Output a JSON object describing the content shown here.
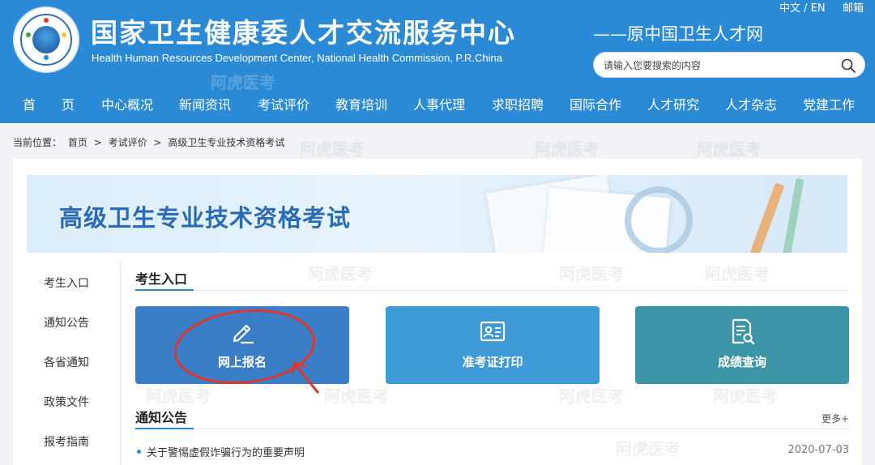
{
  "header": {
    "title_cn": "国家卫生健康委人才交流服务中心",
    "title_en": "Health Human Resources Development Center, National Health Commission, P.R.China",
    "former_name": "——原中国卫生人才网",
    "lang_switch": "中文 / EN",
    "mail": "邮箱",
    "search_placeholder": "请输入您要搜索的内容"
  },
  "nav": {
    "items": [
      "首　　页",
      "中心概况",
      "新闻资讯",
      "考试评价",
      "教育培训",
      "人事代理",
      "求职招聘",
      "国际合作",
      "人才研究",
      "人才杂志",
      "党建工作"
    ]
  },
  "breadcrumb": {
    "prefix": "当前位置：",
    "items": [
      "首页",
      ">",
      "考试评价",
      ">",
      "高级卫生专业技术资格考试"
    ]
  },
  "banner": {
    "title": "高级卫生专业技术资格考试"
  },
  "sidebar": {
    "items": [
      "考生入口",
      "通知公告",
      "各省通知",
      "政策文件",
      "报考指南"
    ]
  },
  "entry": {
    "title": "考生入口",
    "cards": [
      {
        "label": "网上报名",
        "icon": "edit-pen-icon",
        "color": "#3a7ec7"
      },
      {
        "label": "准考证打印",
        "icon": "id-card-icon",
        "color": "#3f9ad8"
      },
      {
        "label": "成绩查询",
        "icon": "document-search-icon",
        "color": "#3b95a6"
      }
    ]
  },
  "notices": {
    "title": "通知公告",
    "more": "更多+",
    "items": [
      {
        "title": "关于警惕虚假诈骗行为的重要声明",
        "date": "2020-07-03"
      }
    ]
  },
  "watermark": "阿虎医考",
  "colors": {
    "header_bg": "#2b8ad6",
    "accent": "#2b8ad6",
    "annotation": "#e0352b"
  }
}
